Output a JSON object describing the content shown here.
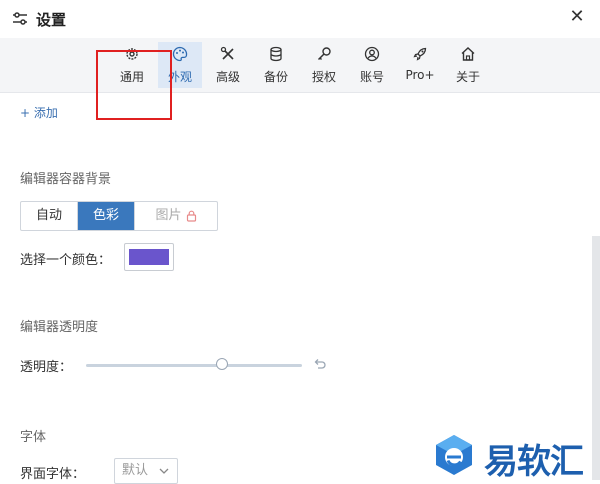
{
  "window": {
    "title": "设置"
  },
  "tabs": [
    {
      "id": "general",
      "label": "通用",
      "icon": "gear-icon"
    },
    {
      "id": "appearance",
      "label": "外观",
      "icon": "palette-icon",
      "active": true
    },
    {
      "id": "advanced",
      "label": "高级",
      "icon": "tools-icon"
    },
    {
      "id": "backup",
      "label": "备份",
      "icon": "database-icon"
    },
    {
      "id": "license",
      "label": "授权",
      "icon": "key-icon"
    },
    {
      "id": "account",
      "label": "账号",
      "icon": "user-circle-icon"
    },
    {
      "id": "pro",
      "label": "Pro+",
      "icon": "rocket-icon"
    },
    {
      "id": "about",
      "label": "关于",
      "icon": "home-icon"
    }
  ],
  "content": {
    "add_label": "+ 添加",
    "bg_section": {
      "title": "编辑器容器背景",
      "options": [
        "自动",
        "色彩",
        "图片"
      ],
      "selected": "色彩"
    },
    "color": {
      "label": "选择一个颜色：",
      "value": "#6a55cc"
    },
    "opacity_section": {
      "title": "编辑器透明度",
      "label": "透明度：",
      "value": 0.63
    },
    "font_section": {
      "title": "字体",
      "label": "界面字体：",
      "selected": "默认"
    }
  },
  "colors": {
    "accent": "#3a78bd",
    "highlight_box": "#e02020"
  },
  "watermark": {
    "text": "易软汇"
  }
}
